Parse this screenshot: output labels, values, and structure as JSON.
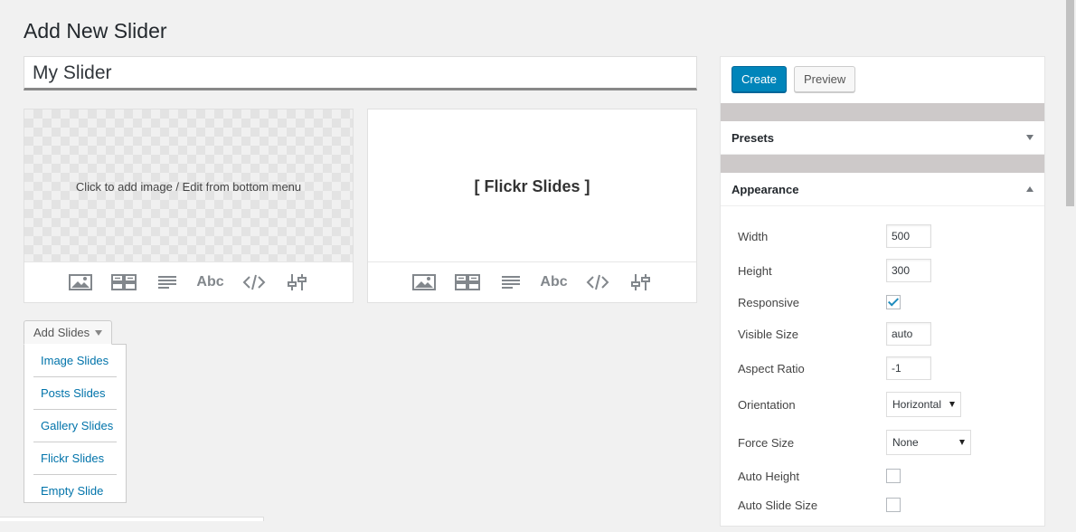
{
  "page": {
    "title": "Add New Slider"
  },
  "slider_name": {
    "value": "My Slider"
  },
  "slides": [
    {
      "hint": "Click to add image / Edit from bottom menu",
      "type": "image"
    },
    {
      "name": "[ Flickr Slides ]",
      "type": "flickr"
    }
  ],
  "toolbar": {
    "icons": [
      "image-icon",
      "layers-icon",
      "content-icon",
      "caption-icon",
      "html-icon",
      "settings-icon"
    ],
    "caption_label": "Abc"
  },
  "add_slides": {
    "label": "Add Slides",
    "items": [
      "Image Slides",
      "Posts Slides",
      "Gallery Slides",
      "Flickr Slides",
      "Empty Slide"
    ]
  },
  "actions": {
    "create": "Create",
    "preview": "Preview"
  },
  "panels": {
    "presets": {
      "title": "Presets"
    },
    "appearance": {
      "title": "Appearance",
      "width": {
        "label": "Width",
        "value": "500"
      },
      "height": {
        "label": "Height",
        "value": "300"
      },
      "responsive": {
        "label": "Responsive",
        "checked": true
      },
      "visible_size": {
        "label": "Visible Size",
        "value": "auto"
      },
      "aspect_ratio": {
        "label": "Aspect Ratio",
        "value": "-1"
      },
      "orientation": {
        "label": "Orientation",
        "value": "Horizontal"
      },
      "force_size": {
        "label": "Force Size",
        "value": "None"
      },
      "auto_height": {
        "label": "Auto Height",
        "checked": false
      },
      "auto_slide_size": {
        "label": "Auto Slide Size",
        "checked": false
      }
    }
  },
  "colors": {
    "primary": "#0085ba",
    "link": "#0073aa",
    "separator": "#cdc9c9"
  }
}
